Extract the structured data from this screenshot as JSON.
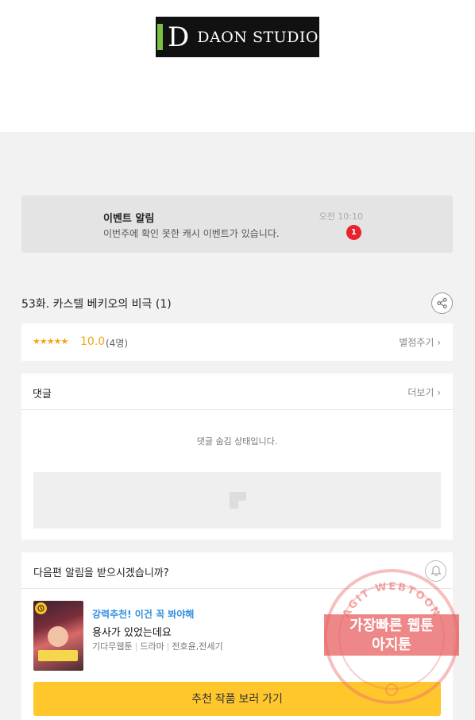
{
  "logo": {
    "mark": "D",
    "text": "DAON STUDIO"
  },
  "event": {
    "title": "이벤트 알림",
    "description": "이번주에 확인 못한 캐시 이벤트가 있습니다.",
    "time": "오전 10:10",
    "badge": "1"
  },
  "episode": {
    "title": "53화. 카스텔 베키오의 비극 (1)",
    "share_icon": "share-icon"
  },
  "rating": {
    "stars": "★★★★★",
    "score": "10.0",
    "count": "(4명)",
    "link": "별점주기 ›"
  },
  "comments": {
    "title": "댓글",
    "more": "더보기 ›",
    "hidden_message": "댓글 숨김 상태입니다."
  },
  "next_episode": {
    "question": "다음편 알림을 받으시겠습니까?",
    "bell_icon": "bell-icon"
  },
  "recommendation": {
    "tag": "강력추천! 이건 꼭 봐야해",
    "title": "용사가 있었는데요",
    "genres": [
      "기다무웹툰",
      "드라마",
      "전호윤,전세기"
    ],
    "cta": "추천 작품 보러 가기"
  },
  "watermark": {
    "arc_text": "AGIT WEBTOON",
    "line1": "가장빠른 웹툰",
    "line2": "아지툰"
  },
  "colors": {
    "accent_yellow": "#ffc72c",
    "star_orange": "#f3a51b",
    "badge_red": "#e8232d",
    "tag_blue": "#2f8fe0"
  }
}
